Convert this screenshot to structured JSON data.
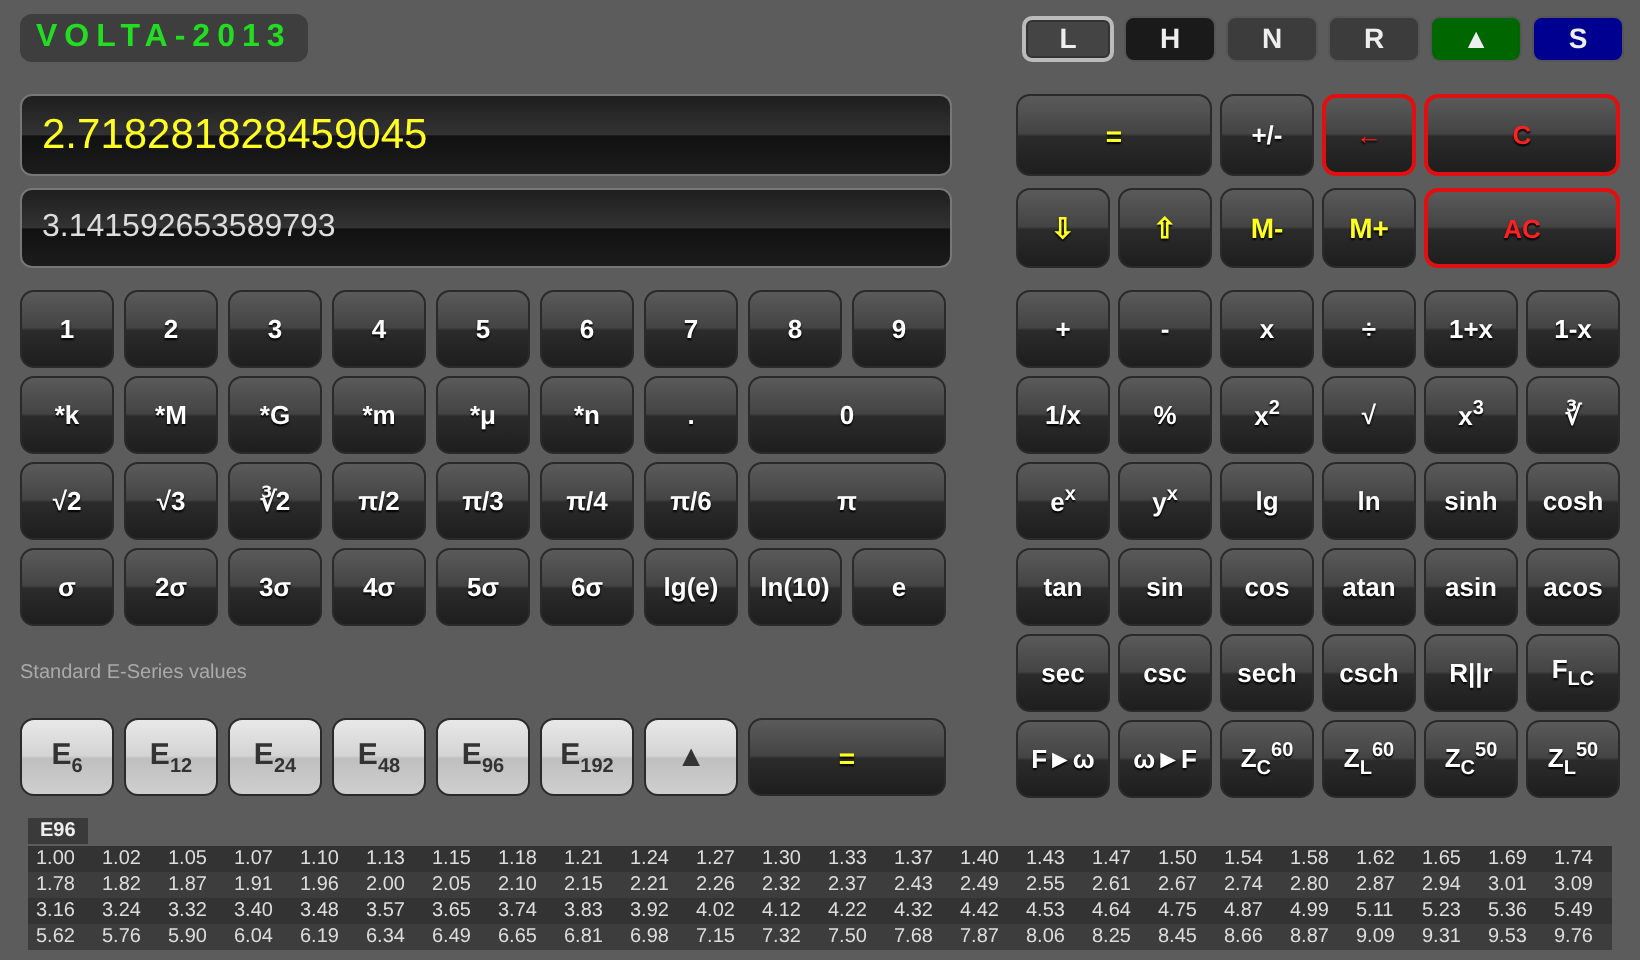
{
  "logo": "VOLTA-2013",
  "modes": [
    {
      "label": "L",
      "selected": true,
      "color": "#444444"
    },
    {
      "label": "H",
      "selected": false,
      "color": "#1a1a1a"
    },
    {
      "label": "N",
      "selected": false,
      "color": "#3c3c3c"
    },
    {
      "label": "R",
      "selected": false,
      "color": "#3c3c3c"
    },
    {
      "label": "▲",
      "selected": false,
      "color": "#006600"
    },
    {
      "label": "S",
      "selected": false,
      "color": "#000090"
    }
  ],
  "display": {
    "primary": "2.718281828459045",
    "secondary": "3.141592653589793"
  },
  "number_keys": [
    {
      "label": "1",
      "kind": "plain"
    },
    {
      "label": "2",
      "kind": "plain"
    },
    {
      "label": "3",
      "kind": "plain"
    },
    {
      "label": "4",
      "kind": "plain"
    },
    {
      "label": "5",
      "kind": "plain"
    },
    {
      "label": "6",
      "kind": "plain"
    },
    {
      "label": "7",
      "kind": "plain"
    },
    {
      "label": "8",
      "kind": "plain"
    },
    {
      "label": "9",
      "kind": "plain"
    },
    {
      "label": "*k",
      "kind": "plain"
    },
    {
      "label": "*M",
      "kind": "plain"
    },
    {
      "label": "*G",
      "kind": "plain"
    },
    {
      "label": "*m",
      "kind": "plain"
    },
    {
      "label": "*μ",
      "kind": "plain"
    },
    {
      "label": "*n",
      "kind": "plain"
    },
    {
      "label": ".",
      "kind": "plain"
    },
    {
      "label": "0",
      "kind": "plain"
    },
    {
      "label": "√2",
      "kind": "plain"
    },
    {
      "label": "√3",
      "kind": "plain"
    },
    {
      "label": "∛2",
      "kind": "plain"
    },
    {
      "label": "π/2",
      "kind": "plain"
    },
    {
      "label": "π/3",
      "kind": "plain"
    },
    {
      "label": "π/4",
      "kind": "plain"
    },
    {
      "label": "π/6",
      "kind": "plain"
    },
    {
      "label": "π",
      "kind": "plain"
    },
    {
      "label": "σ",
      "kind": "plain"
    },
    {
      "label": "2σ",
      "kind": "plain"
    },
    {
      "label": "3σ",
      "kind": "plain"
    },
    {
      "label": "4σ",
      "kind": "plain"
    },
    {
      "label": "5σ",
      "kind": "plain"
    },
    {
      "label": "6σ",
      "kind": "plain"
    },
    {
      "label": "lg(e)",
      "kind": "plain"
    },
    {
      "label": "ln(10)",
      "kind": "plain"
    },
    {
      "label": "e",
      "kind": "plain"
    }
  ],
  "series_label": "Standard E-Series values",
  "series_keys": [
    {
      "label": "E$_{6}$",
      "kind": "light"
    },
    {
      "label": "E$_{12}$",
      "kind": "light"
    },
    {
      "label": "E$_{24}$",
      "kind": "light"
    },
    {
      "label": "E$_{48}$",
      "kind": "light"
    },
    {
      "label": "E$_{96}$",
      "kind": "light"
    },
    {
      "label": "E$_{192}$",
      "kind": "light"
    },
    {
      "label": "▲",
      "kind": "light"
    },
    {
      "label": "=",
      "kind": "yellow"
    }
  ],
  "control_keys": [
    {
      "label": "=",
      "kind": "yellow"
    },
    {
      "label": "+/-",
      "kind": "plain"
    },
    {
      "label": "←",
      "kind": "red"
    },
    {
      "label": "C",
      "kind": "red"
    },
    {
      "label": "⇩",
      "kind": "yellow"
    },
    {
      "label": "⇧",
      "kind": "yellow"
    },
    {
      "label": "M-",
      "kind": "yellow"
    },
    {
      "label": "M+",
      "kind": "yellow"
    },
    {
      "label": "AC",
      "kind": "red"
    }
  ],
  "function_keys": [
    {
      "label": "+",
      "kind": "plain"
    },
    {
      "label": "-",
      "kind": "plain"
    },
    {
      "label": "x",
      "kind": "plain"
    },
    {
      "label": "÷",
      "kind": "plain"
    },
    {
      "label": "1+x",
      "kind": "plain"
    },
    {
      "label": "1-x",
      "kind": "plain"
    },
    {
      "label": "1/x",
      "kind": "plain"
    },
    {
      "label": "%",
      "kind": "plain"
    },
    {
      "label": "x$^{2}$",
      "kind": "plain"
    },
    {
      "label": "√",
      "kind": "plain"
    },
    {
      "label": "x$^{3}$",
      "kind": "plain"
    },
    {
      "label": "∛",
      "kind": "plain"
    },
    {
      "label": "e$^{x}$",
      "kind": "plain"
    },
    {
      "label": "y$^{x}$",
      "kind": "plain"
    },
    {
      "label": "lg",
      "kind": "plain"
    },
    {
      "label": "ln",
      "kind": "plain"
    },
    {
      "label": "sinh",
      "kind": "plain"
    },
    {
      "label": "cosh",
      "kind": "plain"
    },
    {
      "label": "tan",
      "kind": "plain"
    },
    {
      "label": "sin",
      "kind": "plain"
    },
    {
      "label": "cos",
      "kind": "plain"
    },
    {
      "label": "atan",
      "kind": "plain"
    },
    {
      "label": "asin",
      "kind": "plain"
    },
    {
      "label": "acos",
      "kind": "plain"
    },
    {
      "label": "sec",
      "kind": "plain"
    },
    {
      "label": "csc",
      "kind": "plain"
    },
    {
      "label": "sech",
      "kind": "plain"
    },
    {
      "label": "csch",
      "kind": "plain"
    },
    {
      "label": "R||r",
      "kind": "plain"
    },
    {
      "label": "F$_{LC}$",
      "kind": "plain"
    },
    {
      "label": "F►ω",
      "kind": "plain"
    },
    {
      "label": "ω►F",
      "kind": "plain"
    },
    {
      "label": "Z$_{C}$$^{60}$",
      "kind": "plain"
    },
    {
      "label": "Z$_{L}$$^{60}$",
      "kind": "plain"
    },
    {
      "label": "Z$_{C}$$^{50}$",
      "kind": "plain"
    },
    {
      "label": "Z$_{L}$$^{50}$",
      "kind": "plain"
    }
  ],
  "table": {
    "tab": "E96",
    "rows": [
      [
        "1.00",
        "1.02",
        "1.05",
        "1.07",
        "1.10",
        "1.13",
        "1.15",
        "1.18",
        "1.21",
        "1.24",
        "1.27",
        "1.30",
        "1.33",
        "1.37",
        "1.40",
        "1.43",
        "1.47",
        "1.50",
        "1.54",
        "1.58",
        "1.62",
        "1.65",
        "1.69",
        "1.74"
      ],
      [
        "1.78",
        "1.82",
        "1.87",
        "1.91",
        "1.96",
        "2.00",
        "2.05",
        "2.10",
        "2.15",
        "2.21",
        "2.26",
        "2.32",
        "2.37",
        "2.43",
        "2.49",
        "2.55",
        "2.61",
        "2.67",
        "2.74",
        "2.80",
        "2.87",
        "2.94",
        "3.01",
        "3.09"
      ],
      [
        "3.16",
        "3.24",
        "3.32",
        "3.40",
        "3.48",
        "3.57",
        "3.65",
        "3.74",
        "3.83",
        "3.92",
        "4.02",
        "4.12",
        "4.22",
        "4.32",
        "4.42",
        "4.53",
        "4.64",
        "4.75",
        "4.87",
        "4.99",
        "5.11",
        "5.23",
        "5.36",
        "5.49"
      ],
      [
        "5.62",
        "5.76",
        "5.90",
        "6.04",
        "6.19",
        "6.34",
        "6.49",
        "6.65",
        "6.81",
        "6.98",
        "7.15",
        "7.32",
        "7.50",
        "7.68",
        "7.87",
        "8.06",
        "8.25",
        "8.45",
        "8.66",
        "8.87",
        "9.09",
        "9.31",
        "9.53",
        "9.76"
      ]
    ]
  }
}
